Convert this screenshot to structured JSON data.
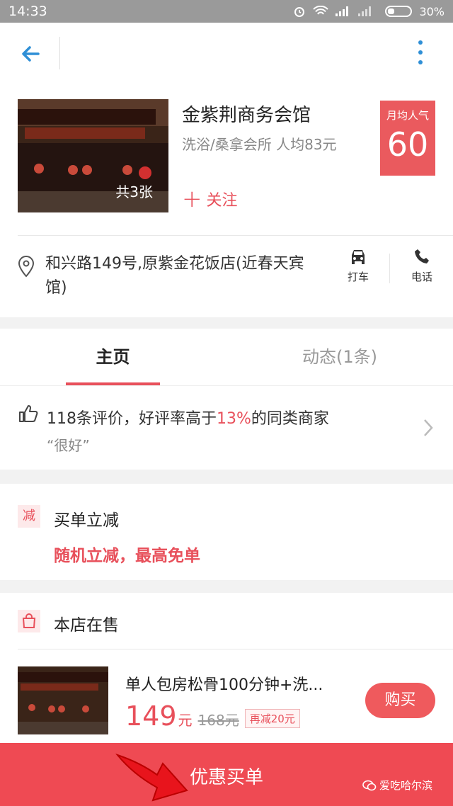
{
  "status_bar": {
    "time": "14:33",
    "battery": "30%"
  },
  "shop": {
    "name": "金紫荆商务会馆",
    "category_price": "洗浴/桑拿会所  人均83元",
    "photo_count": "共3张",
    "follow_label": "关注",
    "popularity_label": "月均人气",
    "popularity_value": "60",
    "address": "和兴路149号,原紫金花饭店(近春天宾馆)",
    "taxi_label": "打车",
    "phone_label": "电话"
  },
  "tabs": [
    {
      "label": "主页"
    },
    {
      "label": "动态(1条)"
    }
  ],
  "review": {
    "prefix": "118条评价，好评率高于",
    "percent": "13%",
    "suffix": "的同类商家",
    "quote": "“很好”"
  },
  "promo": {
    "tag": "减",
    "title": "买单立减",
    "subtitle": "随机立减，最高免单"
  },
  "sale": {
    "title": "本店在售",
    "item": {
      "name": "单人包房松骨100分钟+洗...",
      "price": "149",
      "price_unit": "元",
      "original_price": "168元",
      "discount_badge": "再减20元",
      "buy_label": "购买"
    }
  },
  "bottom_bar": {
    "label": "优惠买单",
    "watermark": "爱吃哈尔滨"
  },
  "colors": {
    "accent": "#e8505b",
    "bottom_bar": "#ef4a53",
    "back_arrow": "#2f8fd6"
  }
}
